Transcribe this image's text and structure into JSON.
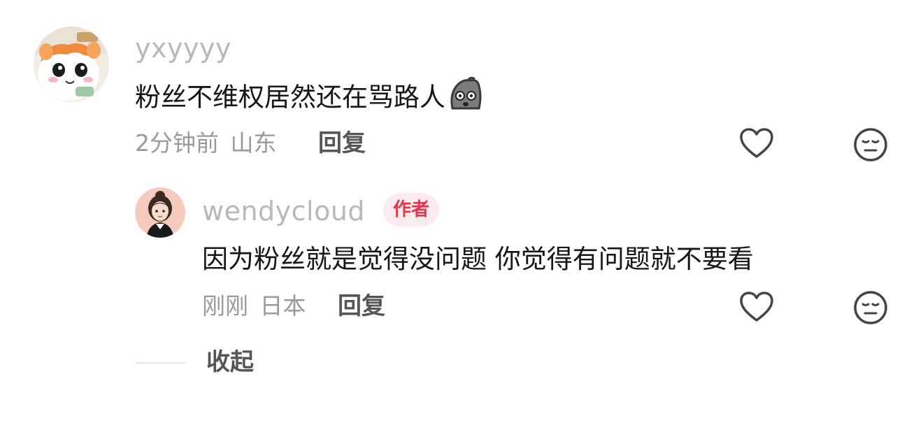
{
  "comment": {
    "username": "yxyyyy",
    "text": "粉丝不维权居然还在骂路人",
    "emoji_icon": "ghost-shocked-emoji-icon",
    "time": "2分钟前",
    "location": "山东",
    "reply_label": "回复"
  },
  "reply": {
    "username": "wendycloud",
    "badge": "作者",
    "text": "因为粉丝就是觉得没问题 你觉得有问题就不要看",
    "time": "刚刚",
    "location": "日本",
    "reply_label": "回复"
  },
  "collapse_label": "收起",
  "colors": {
    "badge_bg": "#fdecef",
    "badge_text": "#e8334a",
    "username": "#b8b8b8",
    "meta": "#9a9a9a"
  }
}
